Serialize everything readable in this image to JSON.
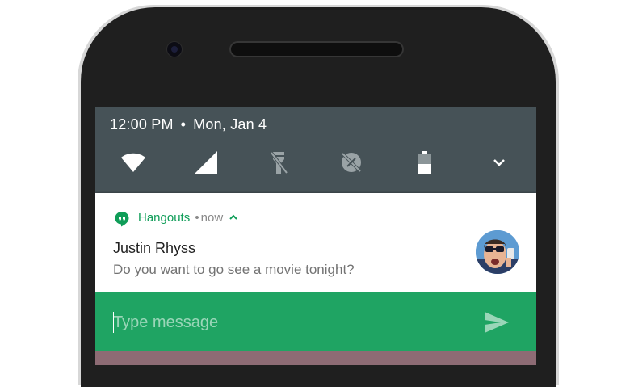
{
  "status_bar": {
    "time": "12:00 PM",
    "separator": "•",
    "date": "Mon, Jan 4"
  },
  "quick_settings": {
    "icons": [
      "wifi-icon",
      "cellular-signal-icon",
      "flashlight-off-icon",
      "location-off-icon",
      "battery-icon",
      "expand-chevron-icon"
    ]
  },
  "notification": {
    "app_name": "Hangouts",
    "separator": "•",
    "time": "now",
    "title": "Justin Rhyss",
    "message": "Do you want to go see a movie tonight?",
    "accent_color": "#0f9d58"
  },
  "reply": {
    "placeholder": "Type message",
    "value": "",
    "background_color": "#1fa463"
  },
  "colors": {
    "shade": "#465257",
    "card": "#ffffff",
    "phone_body": "#1f1f1f"
  }
}
